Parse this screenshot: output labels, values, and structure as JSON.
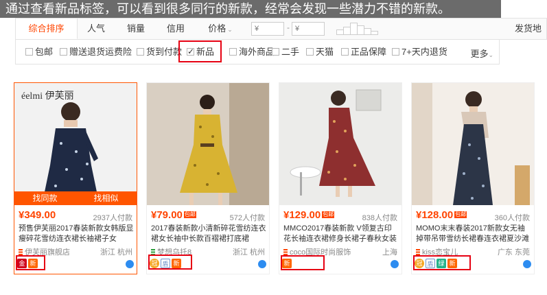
{
  "caption": "通过查看新品标签，可以看到很多同行的新款，经常会发现一些潜力不错的新款。",
  "sort": {
    "items": [
      "综合排序",
      "人气",
      "销量",
      "信用"
    ],
    "price_label": "价格",
    "price_min_placeholder": "¥",
    "price_max_placeholder": "¥",
    "price_dash": "-",
    "shipping_label": "发货地"
  },
  "filters": {
    "items": [
      "包邮",
      "赠送退货运费险",
      "货到付款",
      "新品",
      "海外商品",
      "二手",
      "天猫",
      "正品保障",
      "7+天内退货"
    ],
    "checked": "新品",
    "more_label": "更多"
  },
  "products": [
    {
      "brand_logo": "éelmi 伊芙丽",
      "price": "¥349.00",
      "baoyou": "",
      "sold": "2937人付款",
      "title": "预售伊芙丽2017春装新款女韩版显瘦碎花雪纺连衣裙长袖裙子女",
      "shop": "伊芙丽旗舰店",
      "location": "浙江 杭州",
      "overlay": [
        "找同款",
        "找相似"
      ],
      "badges": [
        "金",
        "新"
      ]
    },
    {
      "price": "¥79.00",
      "baoyou": "包邮",
      "sold": "572人付款",
      "title": "2017春装新款小清新碎花雪纺连衣裙女长袖中长款百褶裙打底裙",
      "shop": "梦想乌托8",
      "location": "浙江 杭州",
      "badges": [
        "冠",
        "盾",
        "新"
      ]
    },
    {
      "price": "¥129.00",
      "baoyou": "包邮",
      "sold": "838人付款",
      "title": "MMCO2017春装新款 V领复古印花长袖连衣裙修身长裙子春秋女装",
      "shop": "coco国际时尚服饰",
      "location": "上海",
      "badges": [
        "新"
      ]
    },
    {
      "price": "¥128.00",
      "baoyou": "包邮",
      "sold": "360人付款",
      "title": "MOMO末末春装2017新款女无袖掉带吊带雪纺长裙春连衣裙夏沙滩裙",
      "shop": "kiss恋宝儿",
      "location": "广东 东莞",
      "badges": [
        "冠",
        "盾",
        "绿",
        "新"
      ]
    }
  ]
}
